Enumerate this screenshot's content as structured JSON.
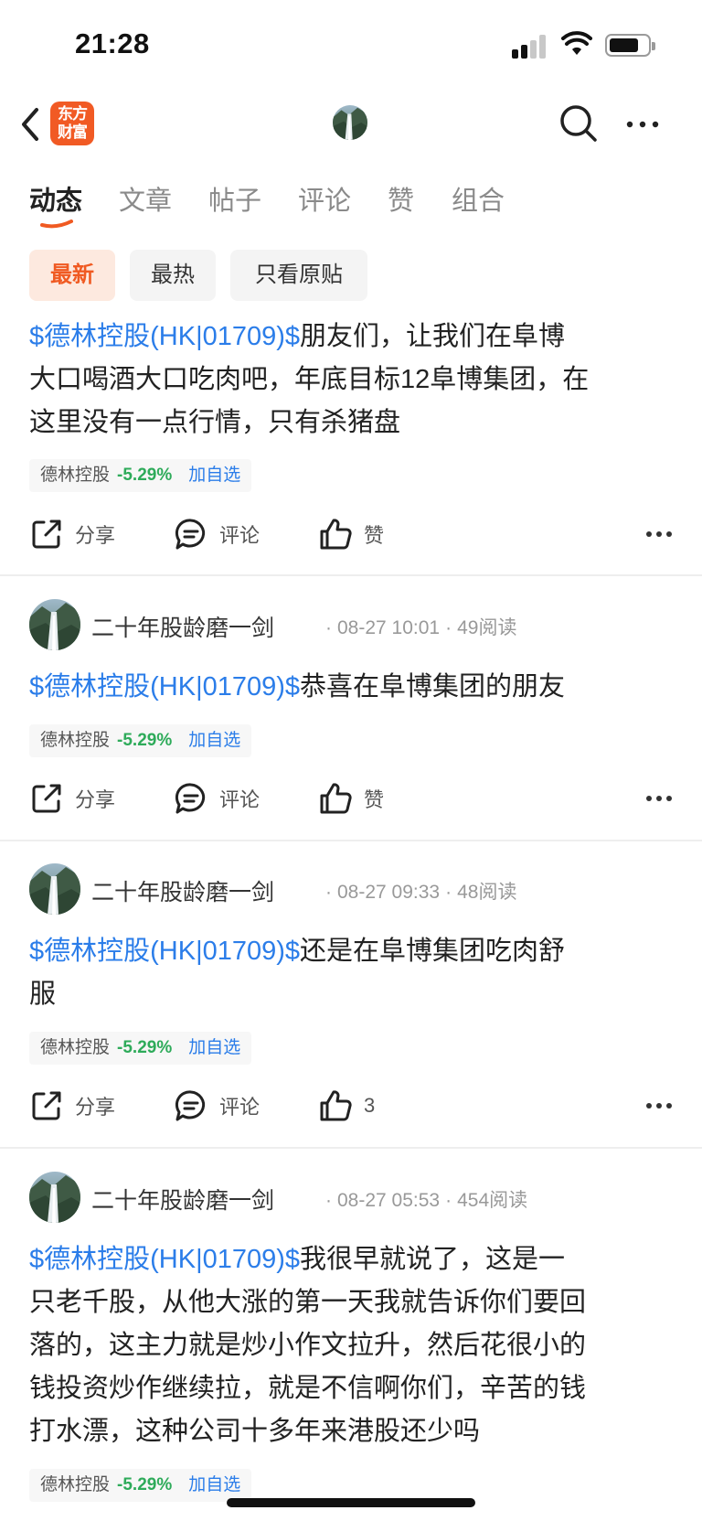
{
  "status_bar": {
    "time": "21:28"
  },
  "nav": {
    "logo_line1": "东方",
    "logo_line2": "财富"
  },
  "tabs": [
    "动态",
    "文章",
    "帖子",
    "评论",
    "赞",
    "组合"
  ],
  "filters": [
    "最新",
    "最热",
    "只看原贴"
  ],
  "colors": {
    "accent": "#f05a22",
    "link": "#2b7de9",
    "stock_down": "#2eab5a"
  },
  "posts": [
    {
      "author": "",
      "text_ticker": "$德林控股(HK|01709)$",
      "text_line1_rest": "朋友们，让我们在阜博",
      "text_line2": "大口喝酒大口吃肉吧，年底目标12阜博集团，在",
      "text_line3": "这里没有一点行情，只有杀猪盘",
      "stock_name": "德林控股",
      "stock_change": "-5.29%",
      "add_label": "加自选",
      "share_label": "分享",
      "comment_label": "评论",
      "like_label": "赞"
    },
    {
      "author": "二十年股龄磨一剑",
      "time": "08-27 10:01",
      "reads": "49阅读",
      "text_ticker": "$德林控股(HK|01709)$",
      "text_line1_rest": "恭喜在阜博集团的朋友",
      "stock_name": "德林控股",
      "stock_change": "-5.29%",
      "add_label": "加自选",
      "share_label": "分享",
      "comment_label": "评论",
      "like_label": "赞"
    },
    {
      "author": "二十年股龄磨一剑",
      "time": "08-27 09:33",
      "reads": "48阅读",
      "text_ticker": "$德林控股(HK|01709)$",
      "text_line1_rest": "还是在阜博集团吃肉舒",
      "text_line2": "服",
      "stock_name": "德林控股",
      "stock_change": "-5.29%",
      "add_label": "加自选",
      "share_label": "分享",
      "comment_label": "评论",
      "like_label": "3"
    },
    {
      "author": "二十年股龄磨一剑",
      "time": "08-27 05:53",
      "reads": "454阅读",
      "text_ticker": "$德林控股(HK|01709)$",
      "text_line1_rest": "我很早就说了，这是一",
      "text_line2": "只老千股，从他大涨的第一天我就告诉你们要回",
      "text_line3": "落的，这主力就是炒小作文拉升，然后花很小的",
      "text_line4": "钱投资炒作继续拉，就是不信啊你们，辛苦的钱",
      "text_line5": "打水漂，这种公司十多年来港股还少吗",
      "stock_name": "德林控股",
      "stock_change": "-5.29%",
      "add_label": "加自选"
    }
  ]
}
